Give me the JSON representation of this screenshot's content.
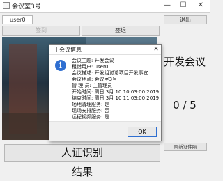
{
  "window": {
    "title": "会议室3号",
    "minimize": "—",
    "maximize": "☐",
    "close": "✕"
  },
  "toolbar": {
    "user_field": "user0",
    "exit_label": "退出",
    "signin_label": "签到",
    "signout_label": "签退"
  },
  "right_panel": {
    "meeting_title": "开发会议",
    "count": "0 / 5",
    "refresh_label": "刷新证件照"
  },
  "bottom": {
    "verify_label": "人证识别",
    "result_label": "结果"
  },
  "dialog": {
    "title": "会议信息",
    "close": "✕",
    "lines": [
      "会议主题:  开发会议",
      "租借用户:  user0",
      "会议描述:  开发组讨论项目开发事宜",
      "会议地点:  会议室3号",
      "管  理  员:  主管理员",
      "开始时间:  周日 3月 10 10:03:00 2019",
      "结束时间:  周日 3月 10 11:03:00 2019",
      "场地清理服务:  是",
      "现场安排服务:  否",
      "远程视频服务:  是"
    ],
    "ok_label": "OK"
  },
  "colors": {
    "accent": "#2f6fd1",
    "window_bg": "#f0f0f0"
  },
  "icons": {
    "app": "window-icon",
    "info": "info-icon"
  }
}
